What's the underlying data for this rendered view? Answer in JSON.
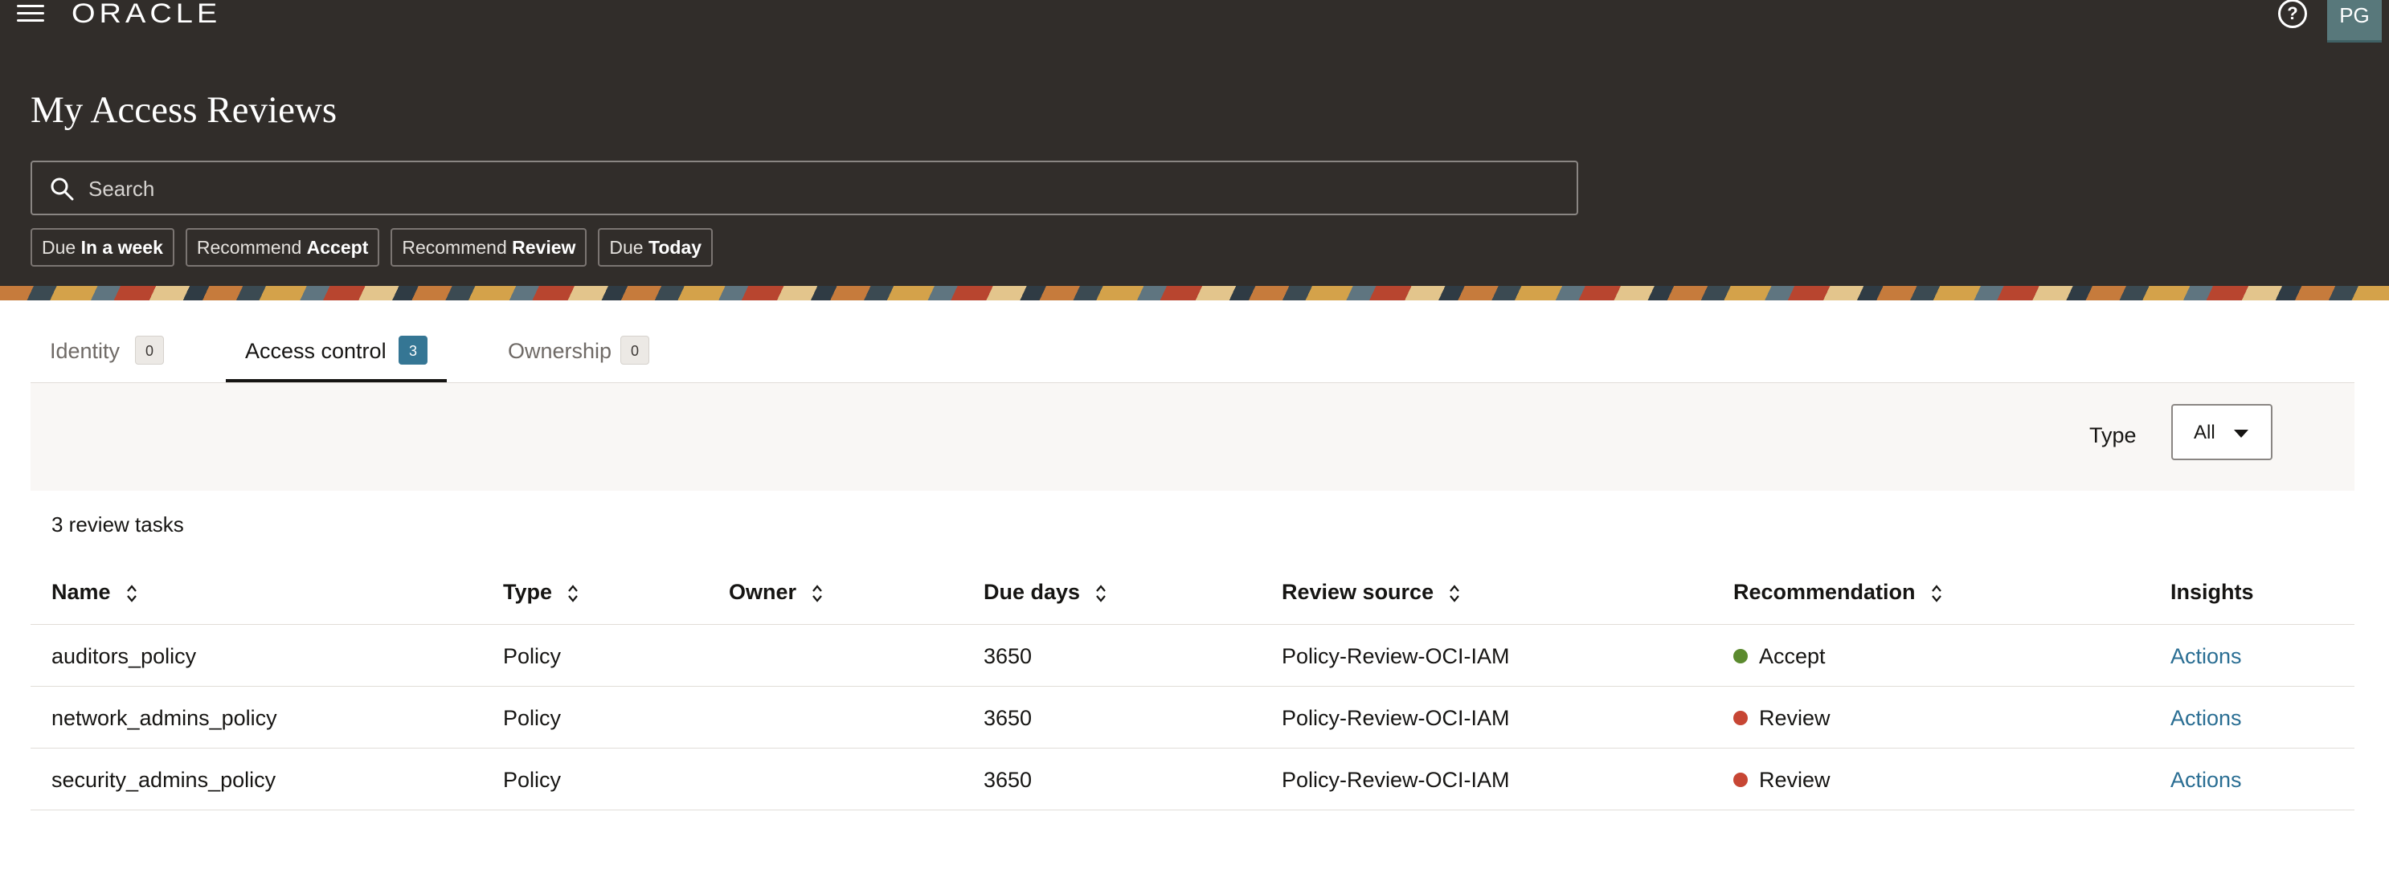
{
  "header": {
    "brand": "ORACLE",
    "avatar_initials": "PG",
    "page_title": "My Access Reviews",
    "search_placeholder": "Search",
    "chips": [
      {
        "prefix": "Due",
        "value": "In a week"
      },
      {
        "prefix": "Recommend",
        "value": "Accept"
      },
      {
        "prefix": "Recommend",
        "value": "Review"
      },
      {
        "prefix": "Due",
        "value": "Today"
      }
    ]
  },
  "tabs": [
    {
      "label": "Identity",
      "count": "0"
    },
    {
      "label": "Access control",
      "count": "3",
      "active": true
    },
    {
      "label": "Ownership",
      "count": "0"
    }
  ],
  "filter": {
    "type_label": "Type",
    "type_value": "All"
  },
  "table": {
    "count_text": "3 review tasks",
    "columns": [
      "Name",
      "Type",
      "Owner",
      "Due days",
      "Review source",
      "Recommendation",
      "Insights"
    ],
    "rows": [
      {
        "name": "auditors_policy",
        "type": "Policy",
        "owner": "",
        "due_days": "3650",
        "review_source": "Policy-Review-OCI-IAM",
        "recommendation": "Accept",
        "rec_color": "#5b8a2e",
        "insights": "Actions"
      },
      {
        "name": "network_admins_policy",
        "type": "Policy",
        "owner": "",
        "due_days": "3650",
        "review_source": "Policy-Review-OCI-IAM",
        "recommendation": "Review",
        "rec_color": "#c74634",
        "insights": "Actions"
      },
      {
        "name": "security_admins_policy",
        "type": "Policy",
        "owner": "",
        "due_days": "3650",
        "review_source": "Policy-Review-OCI-IAM",
        "recommendation": "Review",
        "rec_color": "#c74634",
        "insights": "Actions"
      }
    ]
  }
}
